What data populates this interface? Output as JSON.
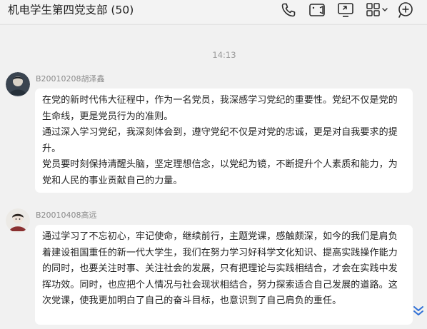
{
  "header": {
    "title": "机电学生第四党支部 (50)",
    "icons": [
      "phone-icon",
      "video-call-icon",
      "screen-share-icon",
      "apps-grid-icon",
      "chevron-down-icon",
      "add-icon"
    ]
  },
  "chat": {
    "timestamp": "14:13",
    "messages": [
      {
        "sender": "B20010208胡泽鑫",
        "paragraphs": [
          "在党的新时代伟大征程中，作为一名党员，我深感学习党纪的重要性。党纪不仅是党的生命线，更是党员行为的准则。",
          "通过深入学习党纪，我深刻体会到，遵守党纪不仅是对党的忠诚，更是对自我要求的提升。",
          "党员要时刻保持清醒头脑，坚定理想信念，以党纪为镜，不断提升个人素质和能力，为党和人民的事业贡献自己的力量。"
        ]
      },
      {
        "sender": "B20010408高远",
        "paragraphs": [
          "通过学习了不忘初心，牢记使命，继续前行，主题党课，感触颇深，如今的我们是肩负着建设祖国重任的新一代大学生，我们在努力学习好科学文化知识、提高实践操作能力的同时，也要关注时事、关注社会的发展，只有把理论与实践相结合，才会在实践中发挥功效。同时，也应把个人情况与社会现状相结合，努力探索适合自己发展的道路。这次党课，使我更加明白了自己的奋斗目标，也意识到了自己肩负的重任。"
        ]
      }
    ]
  },
  "colors": {
    "background": "#f1f1f1",
    "bubble": "#ffffff",
    "meta_text": "#8b8b8b"
  }
}
